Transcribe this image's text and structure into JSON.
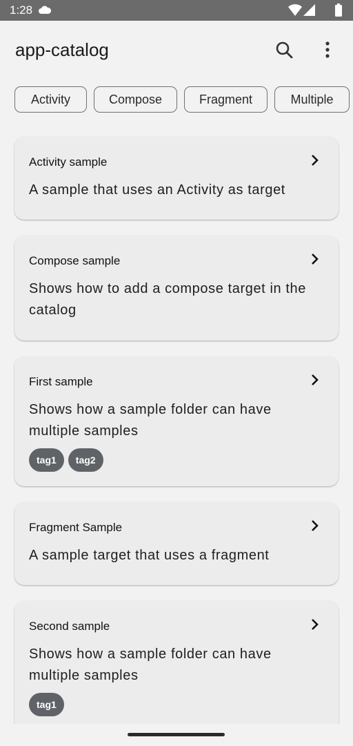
{
  "status_bar": {
    "time": "1:28"
  },
  "app_bar": {
    "title": "app-catalog"
  },
  "chips": [
    "Activity",
    "Compose",
    "Fragment",
    "Multiple"
  ],
  "cards": [
    {
      "title": "Activity sample",
      "description": "A sample that uses an Activity as target",
      "tags": []
    },
    {
      "title": "Compose sample",
      "description": "Shows how to add a compose target in the catalog",
      "tags": []
    },
    {
      "title": "First sample",
      "description": "Shows how a sample folder can have multiple samples",
      "tags": [
        "tag1",
        "tag2"
      ]
    },
    {
      "title": "Fragment Sample",
      "description": "A sample target that uses a fragment",
      "tags": []
    },
    {
      "title": "Second sample",
      "description": "Shows how a sample folder can have multiple samples",
      "tags": [
        "tag1"
      ]
    }
  ],
  "colors": {
    "background": "#f2f2f2",
    "card": "#ececec",
    "tag": "#5f6368",
    "status_bar": "#6b6b6b"
  },
  "icons": [
    "cloud-icon",
    "wifi-icon",
    "signal-icon",
    "battery-icon",
    "search-icon",
    "more-vert-icon",
    "chevron-right-icon"
  ]
}
